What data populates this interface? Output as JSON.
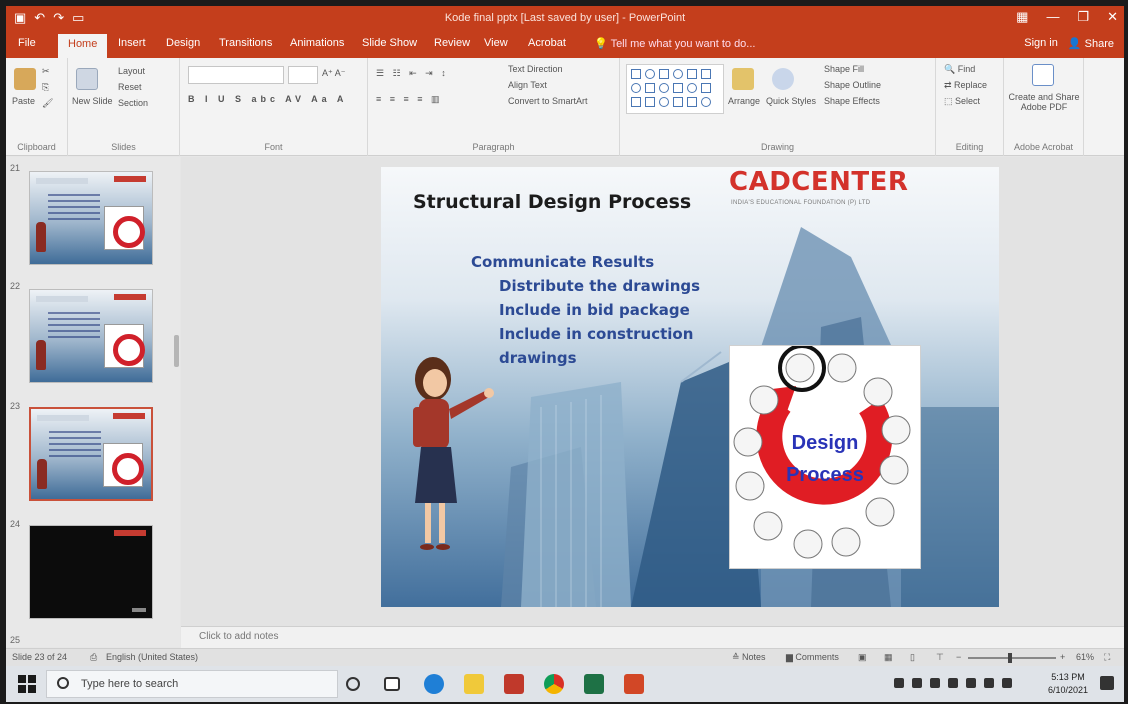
{
  "window": {
    "title": "Kode final pptx [Last saved by user] - PowerPoint",
    "qat_icons": [
      "save-icon",
      "undo-icon",
      "redo-icon",
      "present-icon"
    ],
    "controls": [
      "ribbon-display-icon",
      "minimize-icon",
      "restore-icon",
      "close-icon"
    ]
  },
  "tabs": [
    {
      "label": "File"
    },
    {
      "label": "Home",
      "active": true
    },
    {
      "label": "Insert"
    },
    {
      "label": "Design"
    },
    {
      "label": "Transitions"
    },
    {
      "label": "Animations"
    },
    {
      "label": "Slide Show"
    },
    {
      "label": "Review"
    },
    {
      "label": "View"
    },
    {
      "label": "Acrobat"
    }
  ],
  "tell_me": "Tell me what you want to do...",
  "account": {
    "sign_in": "Sign in",
    "share": "Share"
  },
  "ribbon": {
    "clipboard": {
      "label": "Clipboard",
      "paste": "Paste"
    },
    "slides": {
      "label": "Slides",
      "new_slide": "New Slide",
      "layout": "Layout",
      "reset": "Reset",
      "section": "Section"
    },
    "font": {
      "label": "Font"
    },
    "paragraph": {
      "label": "Paragraph",
      "text_direction": "Text Direction",
      "align_text": "Align Text",
      "smartart": "Convert to SmartArt"
    },
    "drawing": {
      "label": "Drawing",
      "arrange": "Arrange",
      "quick_styles": "Quick Styles",
      "shape_fill": "Shape Fill",
      "shape_outline": "Shape Outline",
      "shape_effects": "Shape Effects"
    },
    "editing": {
      "label": "Editing",
      "find": "Find",
      "replace": "Replace",
      "select": "Select"
    },
    "acrobat": {
      "label": "Adobe Acrobat",
      "create": "Create and Share Adobe PDF"
    }
  },
  "thumbnails": [
    {
      "num": "21"
    },
    {
      "num": "22"
    },
    {
      "num": "23",
      "active": true
    },
    {
      "num": "24"
    },
    {
      "num": "25"
    }
  ],
  "slide": {
    "title": "Structural Design Process",
    "logo": "CADCENTER",
    "logo_tag": "INDIA'S EDUCATIONAL FOUNDATION (P) LTD",
    "heading": "Communicate Results",
    "bullets": [
      "Distribute the drawings",
      "Include in bid package",
      "Include in construction",
      "drawings"
    ],
    "diagram": {
      "line1": "Design",
      "line2": "Process"
    }
  },
  "notes_placeholder": "Click to add notes",
  "status": {
    "slide_info": "Slide 23 of 24",
    "language": "English (United States)",
    "notes": "Notes",
    "comments": "Comments",
    "zoom": "61%"
  },
  "taskbar": {
    "search_placeholder": "Type here to search",
    "time": "5:13 PM",
    "date": "6/10/2021"
  }
}
